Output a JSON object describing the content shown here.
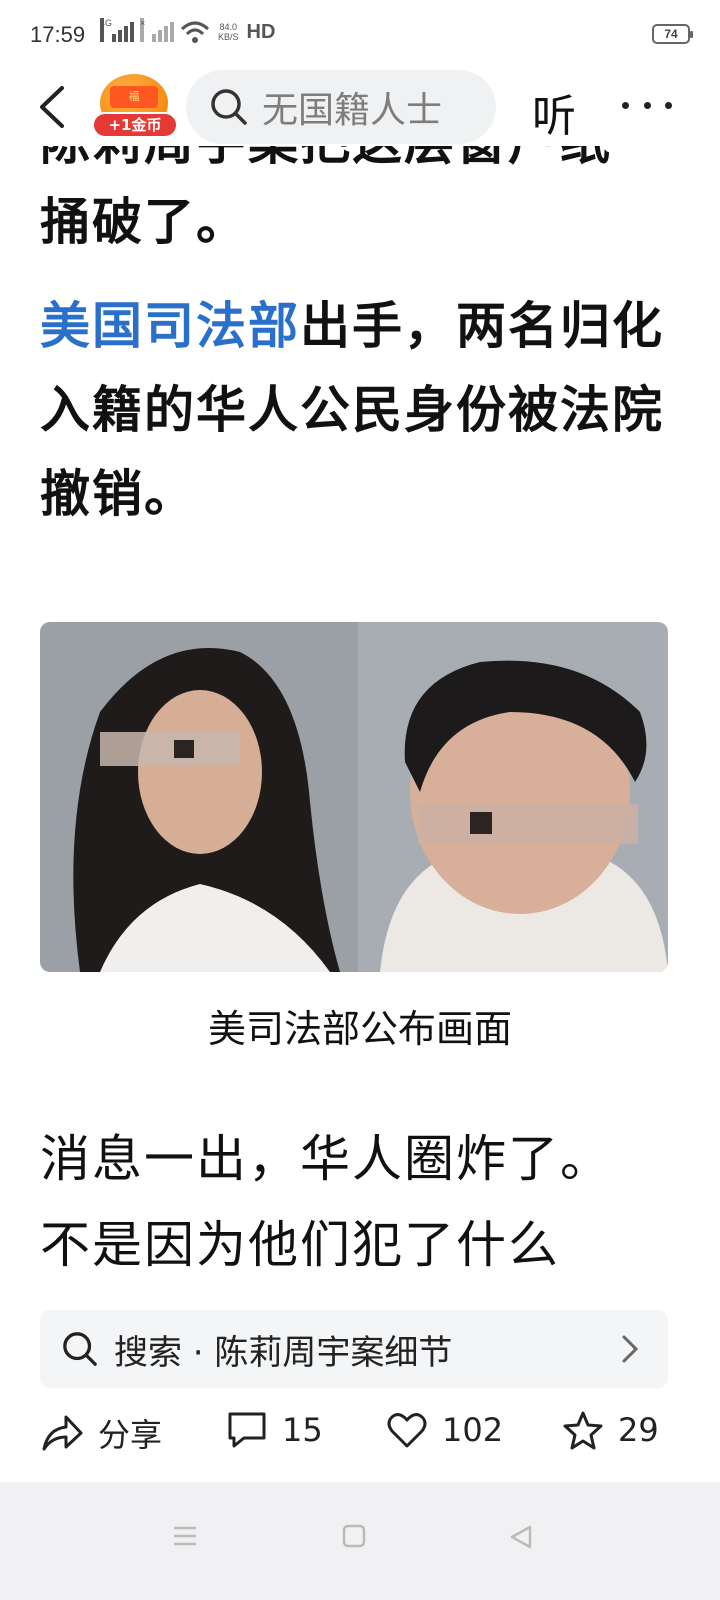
{
  "status_bar": {
    "time": "17:59",
    "sim1_label": "4G",
    "sim2_label": "×",
    "net_speed_value": "84.0",
    "net_speed_unit": "KB/S",
    "hd_label": "HD",
    "battery": "74"
  },
  "header": {
    "back_icon": "chevron-left-icon",
    "coin_reward_label": "+1金币",
    "search_placeholder": "无国籍人士",
    "listen_label": "听",
    "more_icon": "more-horizontal-icon"
  },
  "article": {
    "partial_line": "陈莉周宇案把这层窗户纸",
    "para1_end": "捅破了。",
    "para2_link": "美国司法部",
    "para2_rest": "出手，两名归化入籍的华人公民身份被法院撤销。",
    "image_caption": "美司法部公布画面",
    "para3_line1": "消息一出，华人圈炸了。",
    "para3_line2": "不是因为他们犯了什么"
  },
  "suggestion": {
    "text": "搜索 · 陈莉周宇案细节"
  },
  "actions": {
    "share_label": "分享",
    "comments": "15",
    "likes": "102",
    "favorites": "29"
  },
  "colors": {
    "link": "#2a6fc9",
    "coin_badge": "#e53935",
    "search_bg": "#f0f1f3",
    "navbar_bg": "#f1f1f3"
  }
}
